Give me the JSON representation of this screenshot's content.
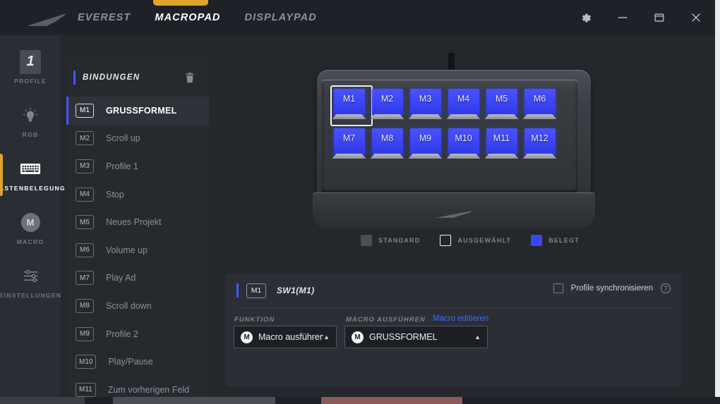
{
  "app": {
    "logo_icon": "wing-swoosh-logo",
    "tabs": [
      {
        "label": "EVEREST",
        "active": false
      },
      {
        "label": "MACROPAD",
        "active": true
      },
      {
        "label": "DISPLAYPAD",
        "active": false
      }
    ],
    "window_controls": [
      {
        "name": "settings-gear",
        "glyph": "gear-icon"
      },
      {
        "name": "minimize",
        "glyph": "minimize-icon"
      },
      {
        "name": "restore",
        "glyph": "restore-icon"
      },
      {
        "name": "close",
        "glyph": "close-icon"
      }
    ]
  },
  "colors": {
    "accent_orange": "#e0a32e",
    "accent_blue": "#3d5afe",
    "key_blue": "#3b44f5",
    "link_blue": "#3d6bfe",
    "panel_bg": "#2b2e34",
    "app_bg": "#24272c",
    "titlebar_bg": "#1e2127"
  },
  "rail": {
    "items": [
      {
        "label": "PROFILE",
        "icon": "profile-number-badge",
        "badge": "1",
        "active": false
      },
      {
        "label": "RGB",
        "icon": "lightbulb-icon",
        "active": false
      },
      {
        "label": "TASTENBELEGUNG",
        "icon": "keyboard-icon",
        "active": true
      },
      {
        "label": "MACRO",
        "icon": "macro-m-circle-icon",
        "badge": "M",
        "active": false
      },
      {
        "label": "EINSTELLUNGEN",
        "icon": "sliders-icon",
        "active": false
      }
    ]
  },
  "bindings": {
    "title": "BINDUNGEN",
    "delete_icon": "trash-icon",
    "rows": [
      {
        "key": "M1",
        "label": "GRUSSFORMEL",
        "active": true
      },
      {
        "key": "M2",
        "label": "Scroll up",
        "active": false
      },
      {
        "key": "M3",
        "label": "Profile 1",
        "active": false
      },
      {
        "key": "M4",
        "label": "Stop",
        "active": false
      },
      {
        "key": "M5",
        "label": "Neues Projekt",
        "active": false
      },
      {
        "key": "M6",
        "label": "Volume up",
        "active": false
      },
      {
        "key": "M7",
        "label": "Play Ad",
        "active": false
      },
      {
        "key": "M8",
        "label": "Scroll down",
        "active": false
      },
      {
        "key": "M9",
        "label": "Profile 2",
        "active": false
      },
      {
        "key": "M10",
        "label": "Play/Pause",
        "active": false
      },
      {
        "key": "M11",
        "label": "Zum vorherigen Feld",
        "active": false
      }
    ]
  },
  "device": {
    "name": "macropad-preview",
    "keys": [
      {
        "label": "M1",
        "selected": true,
        "assigned": true
      },
      {
        "label": "M2",
        "selected": false,
        "assigned": true
      },
      {
        "label": "M3",
        "selected": false,
        "assigned": true
      },
      {
        "label": "M4",
        "selected": false,
        "assigned": true
      },
      {
        "label": "M5",
        "selected": false,
        "assigned": true
      },
      {
        "label": "M6",
        "selected": false,
        "assigned": true
      },
      {
        "label": "M7",
        "selected": false,
        "assigned": true
      },
      {
        "label": "M8",
        "selected": false,
        "assigned": true
      },
      {
        "label": "M9",
        "selected": false,
        "assigned": true
      },
      {
        "label": "M10",
        "selected": false,
        "assigned": true
      },
      {
        "label": "M11",
        "selected": false,
        "assigned": true
      },
      {
        "label": "M12",
        "selected": false,
        "assigned": true
      }
    ],
    "legend": [
      {
        "label": "STANDARD",
        "style": "filled-gray",
        "color": "#4a4e55"
      },
      {
        "label": "AUSGEWÄHLT",
        "style": "outline-white",
        "color": "#f1f2f4"
      },
      {
        "label": "BELEGT",
        "style": "filled-blue",
        "color": "#3b44f5"
      }
    ]
  },
  "config": {
    "key_chip": "M1",
    "switch_name": "SW1(M1)",
    "sync_label": "Profile synchronisieren",
    "sync_checked": false,
    "help_icon": "question-mark-icon",
    "funktion_label": "FUNKTION",
    "funktion_value": "Macro ausführen",
    "funktion_icon": "macro-m-circle-icon",
    "macro_label": "MACRO AUSFÜHREN",
    "macro_value": "GRUSSFORMEL",
    "macro_icon": "macro-m-circle-icon",
    "macro_edit_link": "Macro editieren",
    "caret_icon": "chevron-up-icon"
  }
}
